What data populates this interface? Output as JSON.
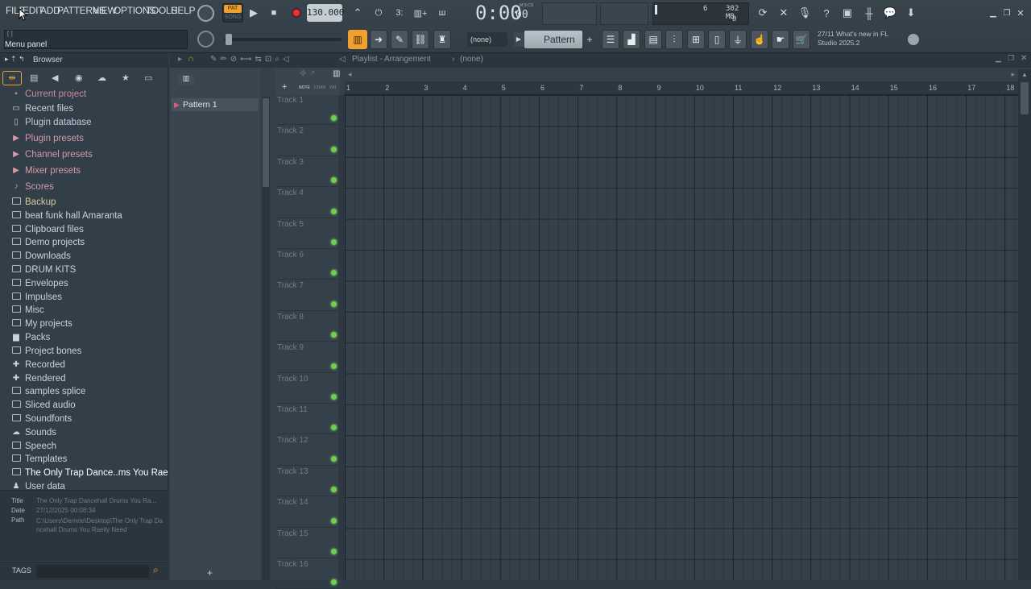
{
  "menu": {
    "items": [
      "FILE",
      "EDIT",
      "ADD",
      "PATTERNS",
      "VIEW",
      "OPTIONS",
      "TOOLS",
      "HELP"
    ],
    "hint": "Menu panel"
  },
  "transport": {
    "pat_label": "PAT",
    "song_label": "SONG",
    "tempo": "130.000",
    "time": "0:00",
    "time_sub": "00",
    "time_unit": "M:S:CS"
  },
  "monitor": {
    "cpu": "6",
    "memory": "302 MB",
    "polyphony": "0"
  },
  "pattern": {
    "none_label": "(none)",
    "current": "Pattern 1"
  },
  "news": {
    "line1": "27/11  What's new in FL",
    "line2": "Studio 2025.2"
  },
  "browser": {
    "title": "Browser",
    "items": [
      {
        "label": "Current project",
        "icon": "project-icon",
        "color": "#c98a9a"
      },
      {
        "label": "Recent files",
        "icon": "recent-icon",
        "color": "#c9d4da"
      },
      {
        "label": "Plugin database",
        "icon": "plugin-db-icon",
        "color": "#c0c9d8"
      },
      {
        "label": "Plugin presets",
        "icon": "plugin-presets-icon",
        "color": "#d49aa8"
      },
      {
        "label": "Channel presets",
        "icon": "channel-presets-icon",
        "color": "#d49aa8"
      },
      {
        "label": "Mixer presets",
        "icon": "mixer-presets-icon",
        "color": "#d49aa8"
      },
      {
        "label": "Scores",
        "icon": "note-icon",
        "color": "#d49aa8"
      },
      {
        "label": "Backup",
        "icon": "folder-icon",
        "color": "#d9c9a0"
      },
      {
        "label": "beat funk hall Amaranta",
        "icon": "folder-icon",
        "color": "#c9d4da"
      },
      {
        "label": "Clipboard files",
        "icon": "folder-icon",
        "color": "#c9d4da"
      },
      {
        "label": "Demo projects",
        "icon": "folder-icon",
        "color": "#c9d4da"
      },
      {
        "label": "Downloads",
        "icon": "folder-icon",
        "color": "#c9d4da"
      },
      {
        "label": "DRUM KITS",
        "icon": "folder-icon",
        "color": "#c9d4da"
      },
      {
        "label": "Envelopes",
        "icon": "folder-icon",
        "color": "#c9d4da"
      },
      {
        "label": "Impulses",
        "icon": "folder-icon",
        "color": "#c9d4da"
      },
      {
        "label": "Misc",
        "icon": "folder-icon",
        "color": "#c9d4da"
      },
      {
        "label": "My projects",
        "icon": "folder-icon",
        "color": "#c9d4da"
      },
      {
        "label": "Packs",
        "icon": "packs-icon",
        "color": "#c9d4da"
      },
      {
        "label": "Project bones",
        "icon": "folder-icon",
        "color": "#c9d4da"
      },
      {
        "label": "Recorded",
        "icon": "recorded-icon",
        "color": "#c9d4da"
      },
      {
        "label": "Rendered",
        "icon": "rendered-icon",
        "color": "#c9d4da"
      },
      {
        "label": "samples splice",
        "icon": "folder-icon",
        "color": "#c9d4da"
      },
      {
        "label": "Sliced audio",
        "icon": "folder-icon",
        "color": "#c9d4da"
      },
      {
        "label": "Soundfonts",
        "icon": "folder-icon",
        "color": "#c9d4da"
      },
      {
        "label": "Sounds",
        "icon": "cloud-icon",
        "color": "#c9d4da"
      },
      {
        "label": "Speech",
        "icon": "folder-icon",
        "color": "#c9d4da"
      },
      {
        "label": "Templates",
        "icon": "folder-icon",
        "color": "#c9d4da"
      },
      {
        "label": "The Only Trap Dance..ms You Raelly Need",
        "icon": "folder-icon",
        "color": "#ffffff"
      },
      {
        "label": "User data",
        "icon": "user-icon",
        "color": "#c9d4da"
      }
    ],
    "info": {
      "title_label": "Title",
      "title_value": "The Only Trap Dancehall Drums You Ra...",
      "date_label": "Date",
      "date_value": "27/12/2025 00:08:34",
      "path_label": "Path",
      "path_value": "C:\\Users\\Derrete\\Desktop\\The Only Trap Dancehall Drums You Raelly Need"
    },
    "tags_label": "TAGS"
  },
  "playlist": {
    "title": "Playlist - Arrangement",
    "sep": "›",
    "context": "(none)",
    "pattern_item": "Pattern 1",
    "header_labels": [
      "NOTE",
      "CHAN",
      "PAT"
    ],
    "tracks": [
      "Track 1",
      "Track 2",
      "Track 3",
      "Track 4",
      "Track 5",
      "Track 6",
      "Track 7",
      "Track 8",
      "Track 9",
      "Track 10",
      "Track 11",
      "Track 12",
      "Track 13",
      "Track 14",
      "Track 15",
      "Track 16"
    ],
    "bars": [
      "1",
      "2",
      "3",
      "4",
      "5",
      "6",
      "7",
      "8",
      "9",
      "10",
      "11",
      "12",
      "13",
      "14",
      "15",
      "16",
      "17",
      "18"
    ]
  },
  "colors": {
    "accent_orange": "#f0a030",
    "record_red": "#e23a3a",
    "track_dot_green": "#6fcf48"
  }
}
